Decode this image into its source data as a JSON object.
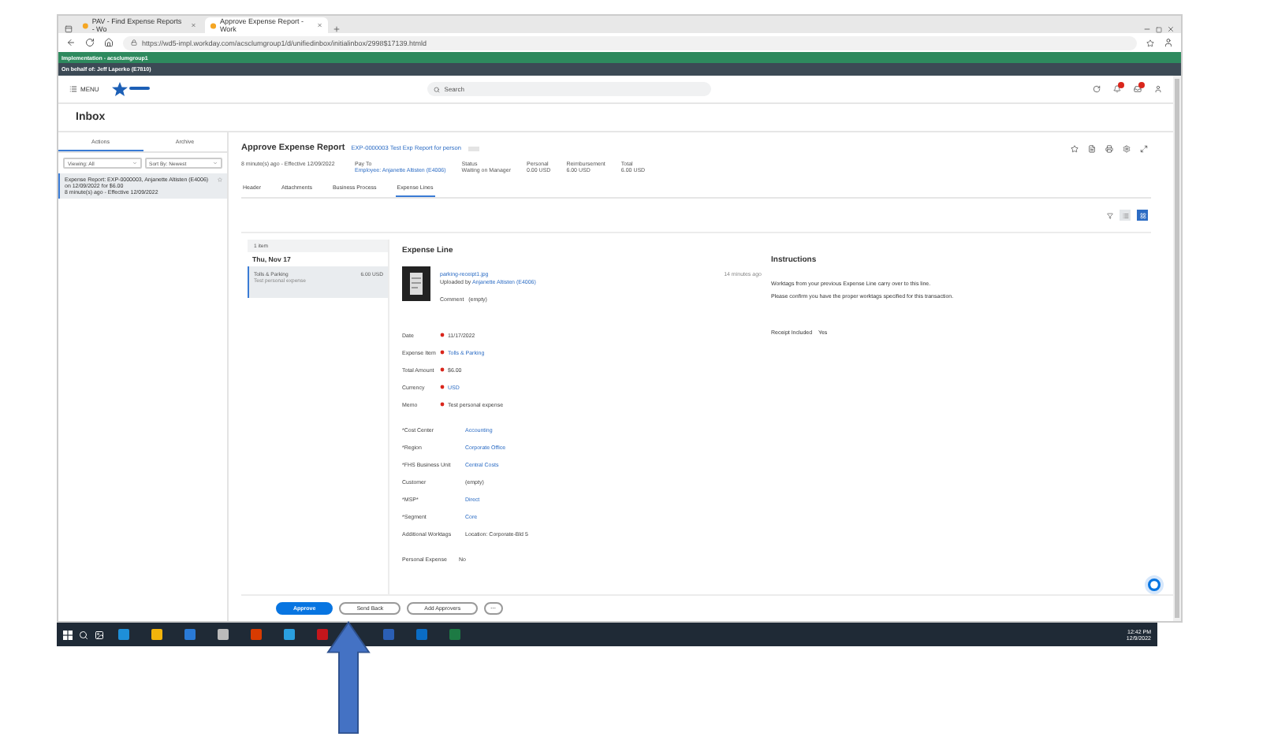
{
  "browser": {
    "tabs": [
      {
        "title": "PAV - Find Expense Reports - Wo",
        "selected": false
      },
      {
        "title": "Approve Expense Report - Work",
        "selected": true
      }
    ],
    "url": "https://wd5-impl.workday.com/acsclumgroup1/d/unifiedinbox/initialinbox/2998$17139.htmld"
  },
  "banner": {
    "environment": "Implementation - acsclumgroup1",
    "on_behalf": "On behalf of: Jeff Laperko (E7810)"
  },
  "header": {
    "menu": "MENU",
    "search_placeholder": "Search"
  },
  "page_title": "Inbox",
  "sidebar": {
    "tabs": [
      {
        "label": "Actions",
        "selected": true
      },
      {
        "label": "Archive",
        "selected": false
      }
    ],
    "filters": [
      "Viewing: All",
      "Sort By: Newest"
    ],
    "items": [
      {
        "title": "Expense Report: EXP-0000003, Anjanette Altisten (E4006) on 12/09/2022 for $6.00",
        "meta": "8 minute(s) ago - Effective 12/09/2022",
        "selected": true
      }
    ]
  },
  "task": {
    "title": "Approve Expense Report",
    "subject": "EXP-0000003 Test Exp Report for person",
    "meta": "8 minute(s) ago - Effective 12/09/2022",
    "summary": [
      {
        "label": "Pay To",
        "value": "Employee: Anjanette Altisten (E4006)",
        "link": true
      },
      {
        "label": "Status",
        "value": "Waiting on Manager",
        "link": false
      },
      {
        "label": "Personal",
        "value": "0.00 USD",
        "link": false
      },
      {
        "label": "Reimbursement",
        "value": "6.00 USD",
        "link": false
      },
      {
        "label": "Total",
        "value": "6.00 USD",
        "link": false
      }
    ],
    "tabs": [
      {
        "label": "Header",
        "selected": false
      },
      {
        "label": "Attachments",
        "selected": false
      },
      {
        "label": "Business Process",
        "selected": false
      },
      {
        "label": "Expense Lines",
        "selected": true
      }
    ]
  },
  "lines": {
    "count": "1 item",
    "date": "Thu, Nov 17",
    "items": [
      {
        "name": "Tolls & Parking",
        "memo": "Test personal expense",
        "amount": "6.00 USD",
        "selected": true
      }
    ]
  },
  "detail": {
    "title": "Expense Line",
    "attachment": {
      "file": "parking-receipt1.jpg",
      "uploaded_by": "Uploaded by",
      "uploader": "Anjanette Altisten (E4006)",
      "time": "14 minutes ago",
      "comment_label": "Comment",
      "comment": "(empty)"
    },
    "fields": [
      {
        "label": "Date",
        "value": "11/17/2022",
        "required": true,
        "link": false
      },
      {
        "label": "Expense Item",
        "value": "Tolls & Parking",
        "required": true,
        "link": true
      },
      {
        "label": "Total Amount",
        "value": "$6.00",
        "required": true,
        "link": false
      },
      {
        "label": "Currency",
        "value": "USD",
        "required": true,
        "link": true
      },
      {
        "label": "Memo",
        "value": "Test personal expense",
        "required": true,
        "link": false
      }
    ],
    "worktags": [
      {
        "label": "*Cost Center",
        "value": "Accounting",
        "link": true
      },
      {
        "label": "*Region",
        "value": "Corporate Office",
        "link": true
      },
      {
        "label": "*FHS Business Unit",
        "value": "Central Costs",
        "link": true
      },
      {
        "label": "Customer",
        "value": "(empty)",
        "link": false
      },
      {
        "label": "*MSP*",
        "value": "Direct",
        "link": true
      },
      {
        "label": "*Segment",
        "value": "Core",
        "link": true
      },
      {
        "label": "Additional Worktags",
        "value": "Location: Corporate-Bld 5",
        "link": false
      }
    ],
    "personal": {
      "label": "Personal Expense",
      "value": "No"
    },
    "instructions": {
      "title": "Instructions",
      "lines": [
        "Worktags from your previous Expense Line carry over to this line.",
        "Please confirm you have the proper worktags specified for this transaction."
      ],
      "receipt_label": "Receipt Included",
      "receipt_value": "Yes"
    }
  },
  "actions": [
    {
      "label": "Approve",
      "kind": "primary"
    },
    {
      "label": "Send Back",
      "kind": "secondary"
    },
    {
      "label": "Add Approvers",
      "kind": "secondary"
    },
    {
      "label": "⋯",
      "kind": "more"
    }
  ],
  "taskbar": {
    "time": "12:42 PM",
    "date": "12/9/2022"
  }
}
